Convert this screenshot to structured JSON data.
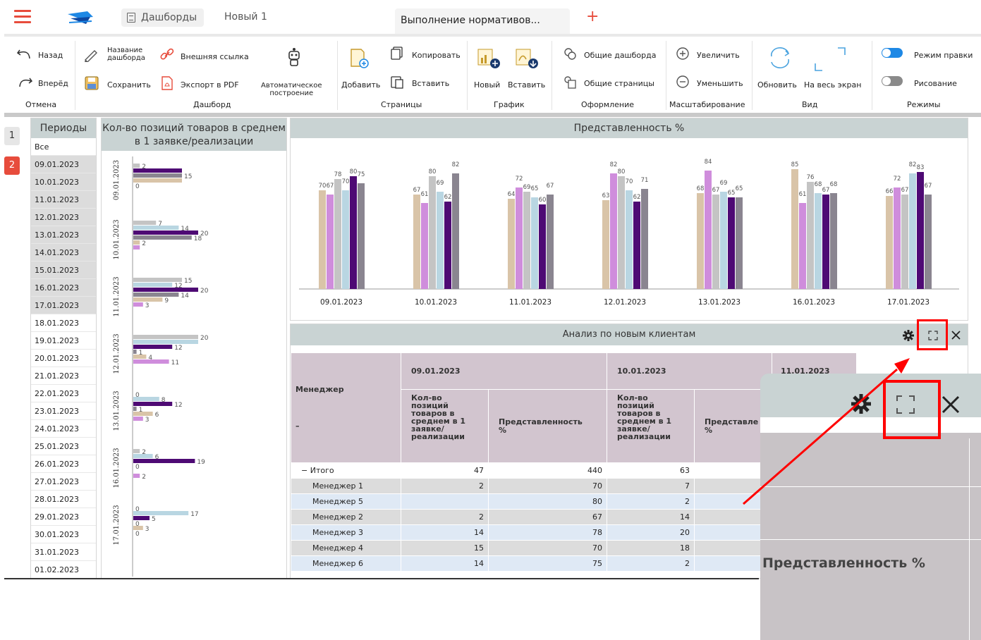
{
  "topbar": {
    "tab_dash": "Дашборды",
    "tab_new": "Новый 1",
    "tab_active": "Выполнение нормативов...",
    "add": "+"
  },
  "ribbon": {
    "back": "Назад",
    "forward": "Вперёд",
    "undo_group": "Отмена",
    "dash_name": "Название\nдашборда",
    "external_link": "Внешняя ссылка",
    "save": "Сохранить",
    "export_pdf": "Экспорт в PDF",
    "auto_build": "Автоматическое\nпостроение",
    "dash_group": "Дашборд",
    "add": "Добавить",
    "copy": "Копировать",
    "paste": "Вставить",
    "pages_group": "Страницы",
    "new_chart": "Новый",
    "paste_chart": "Вставить",
    "chart_group": "График",
    "common_dash": "Общие дашборда",
    "common_pages": "Общие страницы",
    "design_group": "Оформление",
    "zoom_in": "Увеличить",
    "zoom_out": "Уменьшить",
    "scale_group": "Масштабирование",
    "refresh": "Обновить",
    "fullscreen": "На весь экран",
    "view_group": "Вид",
    "edit_mode": "Режим правки",
    "drawing": "Рисование",
    "modes_group": "Режимы"
  },
  "pagetabs": [
    "1",
    "2"
  ],
  "periods": {
    "title": "Периоды",
    "items": [
      "Все",
      "09.01.2023",
      "10.01.2023",
      "11.01.2023",
      "12.01.2023",
      "13.01.2023",
      "14.01.2023",
      "15.01.2023",
      "16.01.2023",
      "17.01.2023",
      "18.01.2023",
      "19.01.2023",
      "20.01.2023",
      "21.01.2023",
      "22.01.2023",
      "23.01.2023",
      "24.01.2023",
      "25.01.2023",
      "26.01.2023",
      "27.01.2023",
      "28.01.2023",
      "29.01.2023",
      "30.01.2023",
      "31.01.2023",
      "01.02.2023"
    ],
    "selected": [
      1,
      2,
      3,
      4,
      5,
      6,
      7,
      8,
      9
    ]
  },
  "colors": {
    "beige": "#d9c4a8",
    "pink": "#cf8ddc",
    "gray": "#c4c4c4",
    "lightblue": "#b9d6e2",
    "purple": "#4e0a74",
    "slate": "#8a8590",
    "header": "#c9d3d3",
    "accent": "#e74c3c"
  },
  "chart_data": [
    {
      "type": "bar",
      "orientation": "horizontal",
      "title": "Кол-во позиций товаров в среднем в 1 заявке/реализации",
      "categories": [
        "09.01.2023",
        "10.01.2023",
        "11.01.2023",
        "12.01.2023",
        "13.01.2023",
        "16.01.2023",
        "17.01.2023"
      ],
      "groups": [
        [
          {
            "v": 2,
            "c": "gray",
            "lbl": "2"
          },
          {
            "v": 15,
            "c": "purple",
            "lbl": ""
          },
          {
            "v": 15,
            "c": "slate",
            "lbl": "15"
          },
          {
            "v": 15,
            "c": "beige",
            "lbl": ""
          },
          {
            "v": 0,
            "c": "pink",
            "lbl": "0"
          }
        ],
        [
          {
            "v": 7,
            "c": "gray",
            "lbl": "7"
          },
          {
            "v": 14,
            "c": "lightblue",
            "lbl": "14"
          },
          {
            "v": 20,
            "c": "purple",
            "lbl": "20"
          },
          {
            "v": 18,
            "c": "slate",
            "lbl": "18"
          },
          {
            "v": 2,
            "c": "beige",
            "lbl": "2"
          },
          {
            "v": 2,
            "c": "pink",
            "lbl": ""
          }
        ],
        [
          {
            "v": 15,
            "c": "gray",
            "lbl": "15"
          },
          {
            "v": 12,
            "c": "lightblue",
            "lbl": "12"
          },
          {
            "v": 20,
            "c": "purple",
            "lbl": "20"
          },
          {
            "v": 14,
            "c": "slate",
            "lbl": "14"
          },
          {
            "v": 9,
            "c": "beige",
            "lbl": "9"
          },
          {
            "v": 3,
            "c": "pink",
            "lbl": "3"
          }
        ],
        [
          {
            "v": 20,
            "c": "gray",
            "lbl": "20"
          },
          {
            "v": 20,
            "c": "lightblue",
            "lbl": ""
          },
          {
            "v": 12,
            "c": "purple",
            "lbl": "12"
          },
          {
            "v": 1,
            "c": "slate",
            "lbl": "1"
          },
          {
            "v": 4,
            "c": "beige",
            "lbl": "4"
          },
          {
            "v": 11,
            "c": "pink",
            "lbl": "11"
          }
        ],
        [
          {
            "v": 0,
            "c": "gray",
            "lbl": "0"
          },
          {
            "v": 8,
            "c": "lightblue",
            "lbl": "8"
          },
          {
            "v": 12,
            "c": "purple",
            "lbl": "12"
          },
          {
            "v": 1,
            "c": "slate",
            "lbl": "1"
          },
          {
            "v": 6,
            "c": "beige",
            "lbl": "6"
          },
          {
            "v": 3,
            "c": "pink",
            "lbl": "3"
          }
        ],
        [
          {
            "v": 2,
            "c": "gray",
            "lbl": "2"
          },
          {
            "v": 6,
            "c": "lightblue",
            "lbl": "6"
          },
          {
            "v": 19,
            "c": "purple",
            "lbl": "19"
          },
          {
            "v": 0,
            "c": "slate",
            "lbl": "0"
          },
          {
            "v": 0,
            "c": "beige",
            "lbl": ""
          },
          {
            "v": 2,
            "c": "pink",
            "lbl": "2"
          }
        ],
        [
          {
            "v": 0,
            "c": "gray",
            "lbl": "0"
          },
          {
            "v": 17,
            "c": "lightblue",
            "lbl": "17"
          },
          {
            "v": 5,
            "c": "purple",
            "lbl": "5"
          },
          {
            "v": 0,
            "c": "slate",
            "lbl": "0"
          },
          {
            "v": 3,
            "c": "beige",
            "lbl": "3"
          },
          {
            "v": 0,
            "c": "pink",
            "lbl": "0"
          }
        ]
      ]
    },
    {
      "type": "bar",
      "title": "Представленность %",
      "categories": [
        "09.01.2023",
        "10.01.2023",
        "11.01.2023",
        "12.01.2023",
        "13.01.2023",
        "16.01.2023",
        "17.01.2023"
      ],
      "series_colors": [
        "beige",
        "pink",
        "gray",
        "lightblue",
        "purple",
        "slate"
      ],
      "values": [
        [
          70,
          67,
          78,
          70,
          80,
          75
        ],
        [
          67,
          61,
          80,
          69,
          62,
          82
        ],
        [
          64,
          72,
          69,
          65,
          60,
          67
        ],
        [
          63,
          82,
          80,
          70,
          62,
          71
        ],
        [
          68,
          84,
          67,
          69,
          65,
          65
        ],
        [
          85,
          61,
          76,
          68,
          67,
          68
        ],
        [
          66,
          72,
          67,
          82,
          83,
          67
        ]
      ]
    }
  ],
  "analysis": {
    "title": "Анализ по новым клиентам",
    "manager_header": "Менеджер",
    "dates": [
      "09.01.2023",
      "10.01.2023",
      "11.01.2023"
    ],
    "col_qty": "Кол-во\nпозиций\nтоваров в\nсреднем в 1\nзаявке/\nреализации",
    "col_pct": "Представленность\n%",
    "col_pct_cut": "Представле\n%",
    "rows": [
      {
        "name": "− Итого",
        "q1": "47",
        "p1": "440",
        "q2": "63"
      },
      {
        "name": "Менеджер 1",
        "q1": "2",
        "p1": "70",
        "q2": "7"
      },
      {
        "name": "Менеджер 5",
        "q1": "",
        "p1": "80",
        "q2": "2"
      },
      {
        "name": "Менеджер 2",
        "q1": "2",
        "p1": "67",
        "q2": "14"
      },
      {
        "name": "Менеджер 3",
        "q1": "14",
        "p1": "78",
        "q2": "20"
      },
      {
        "name": "Менеджер 4",
        "q1": "15",
        "p1": "70",
        "q2": "18"
      },
      {
        "name": "Менеджер 6",
        "q1": "14",
        "p1": "75",
        "q2": "2"
      }
    ]
  },
  "zoom": {
    "label": "Представленность %"
  }
}
